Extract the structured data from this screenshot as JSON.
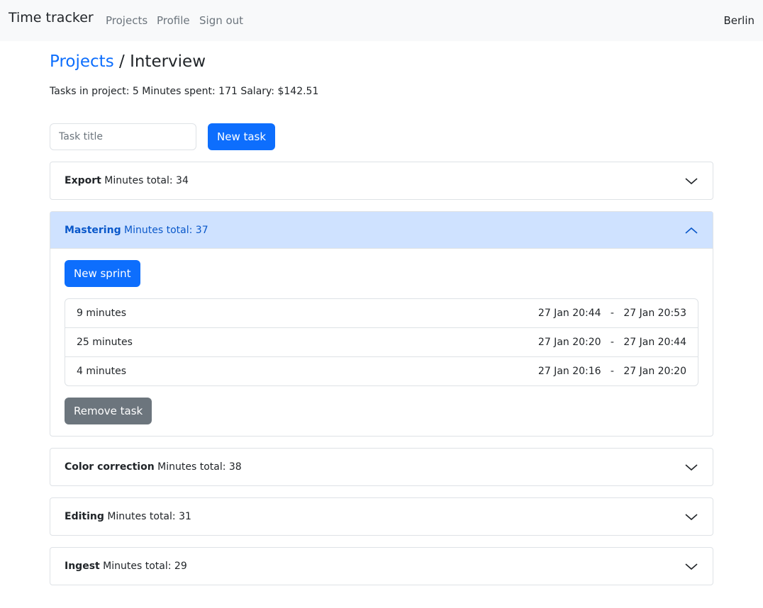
{
  "navbar": {
    "brand": "Time tracker",
    "links": [
      "Projects",
      "Profile",
      "Sign out"
    ],
    "city": "Berlin"
  },
  "breadcrumb": {
    "parent": "Projects",
    "separator": "/",
    "current": "Interview"
  },
  "stats": "Tasks in project: 5 Minutes spent: 171 Salary: $142.51",
  "new_task": {
    "placeholder": "Task title",
    "button_label": "New task"
  },
  "tasks": [
    {
      "name": "Export",
      "minutes_label": "Minutes total: 34",
      "expanded": false
    },
    {
      "name": "Mastering",
      "minutes_label": "Minutes total: 37",
      "expanded": true,
      "new_sprint_label": "New sprint",
      "sprints": [
        {
          "duration": "9 minutes",
          "start": "27 Jan 20:44",
          "end": "27 Jan 20:53"
        },
        {
          "duration": "25 minutes",
          "start": "27 Jan 20:20",
          "end": "27 Jan 20:44"
        },
        {
          "duration": "4 minutes",
          "start": "27 Jan 20:16",
          "end": "27 Jan 20:20"
        }
      ],
      "remove_label": "Remove task"
    },
    {
      "name": "Color correction",
      "minutes_label": "Minutes total: 38",
      "expanded": false
    },
    {
      "name": "Editing",
      "minutes_label": "Minutes total: 31",
      "expanded": false
    },
    {
      "name": "Ingest",
      "minutes_label": "Minutes total: 29",
      "expanded": false
    }
  ],
  "icons": {
    "collapsed": "chevron-down-icon",
    "expanded": "chevron-up-icon"
  },
  "colors": {
    "primary": "#0d6efd",
    "secondary": "#6c757d",
    "active_header": "#cfe2ff"
  }
}
